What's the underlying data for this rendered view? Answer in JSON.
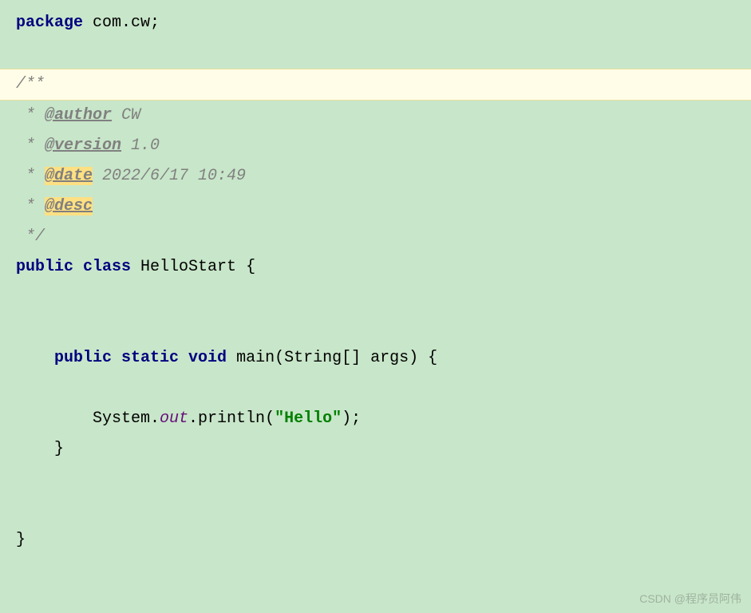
{
  "code": {
    "package_keyword": "package",
    "package_name": " com.cw;",
    "javadoc": {
      "open": "/**",
      "star": " * ",
      "author_tag": "@author",
      "author_value": " CW",
      "version_tag": "@version",
      "version_value": " 1.0",
      "date_tag": "@date",
      "date_value": " 2022/6/17 10:49",
      "desc_tag": "@desc",
      "close": " */"
    },
    "class_decl": {
      "public": "public",
      "class": " class",
      "name": " HelloStart ",
      "open_brace": "{"
    },
    "method": {
      "public": "public",
      "static": " static",
      "void": " void",
      "name": " main",
      "params_open": "(",
      "param_type": "String[]",
      "param_name": " args",
      "params_close": ") ",
      "open_brace": "{",
      "stmt_system": "System.",
      "stmt_out": "out",
      "stmt_println": ".println(",
      "stmt_string": "\"Hello\"",
      "stmt_end": ");",
      "close_brace": "}"
    },
    "class_close": "}"
  },
  "watermark": "CSDN @程序员阿伟"
}
